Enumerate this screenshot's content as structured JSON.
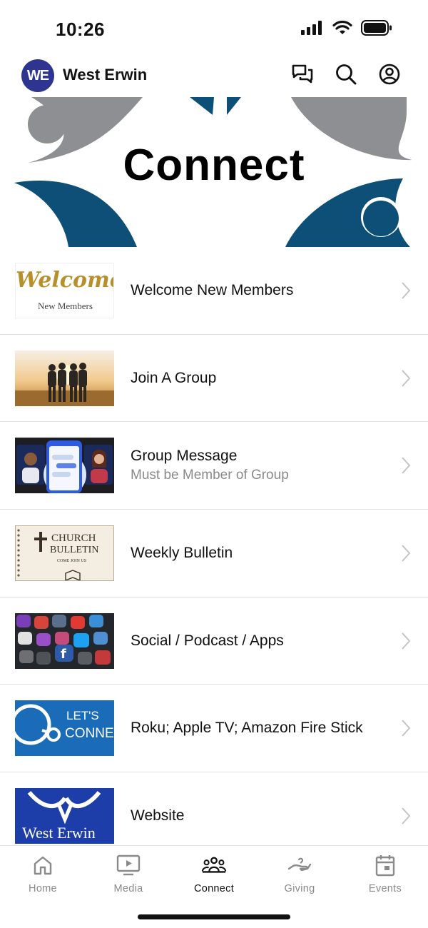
{
  "status_bar": {
    "time": "10:26"
  },
  "app": {
    "logo_text": "WE",
    "title": "West Erwin"
  },
  "hero": {
    "title": "Connect"
  },
  "list": [
    {
      "title": "Welcome New Members",
      "subtitle": "",
      "thumb": {
        "script": "Welcome",
        "caption": "New Members"
      }
    },
    {
      "title": "Join A Group",
      "subtitle": ""
    },
    {
      "title": "Group Message",
      "subtitle": "Must be Member of Group"
    },
    {
      "title": "Weekly Bulletin",
      "subtitle": "",
      "thumb": {
        "line1": "CHURCH",
        "line2": "BULLETIN",
        "line3": "COME JOIN US"
      }
    },
    {
      "title": "Social / Podcast / Apps",
      "subtitle": ""
    },
    {
      "title": "Roku; Apple TV; Amazon Fire Stick",
      "subtitle": "",
      "thumb": {
        "line1": "LET'S",
        "line2": "CONNECT"
      }
    },
    {
      "title": "Website",
      "subtitle": "",
      "thumb": {
        "text": "West Erwin"
      }
    }
  ],
  "tabs": [
    {
      "label": "Home",
      "icon": "home-icon",
      "active": false
    },
    {
      "label": "Media",
      "icon": "media-icon",
      "active": false
    },
    {
      "label": "Connect",
      "icon": "connect-icon",
      "active": true
    },
    {
      "label": "Giving",
      "icon": "giving-icon",
      "active": false
    },
    {
      "label": "Events",
      "icon": "events-icon",
      "active": false
    }
  ],
  "colors": {
    "brand": "#2e3590",
    "hero_blue": "#0e4f77",
    "hero_gray": "#8e8f92",
    "tab_active": "#111111",
    "tab_inactive": "#8a8a8a"
  }
}
